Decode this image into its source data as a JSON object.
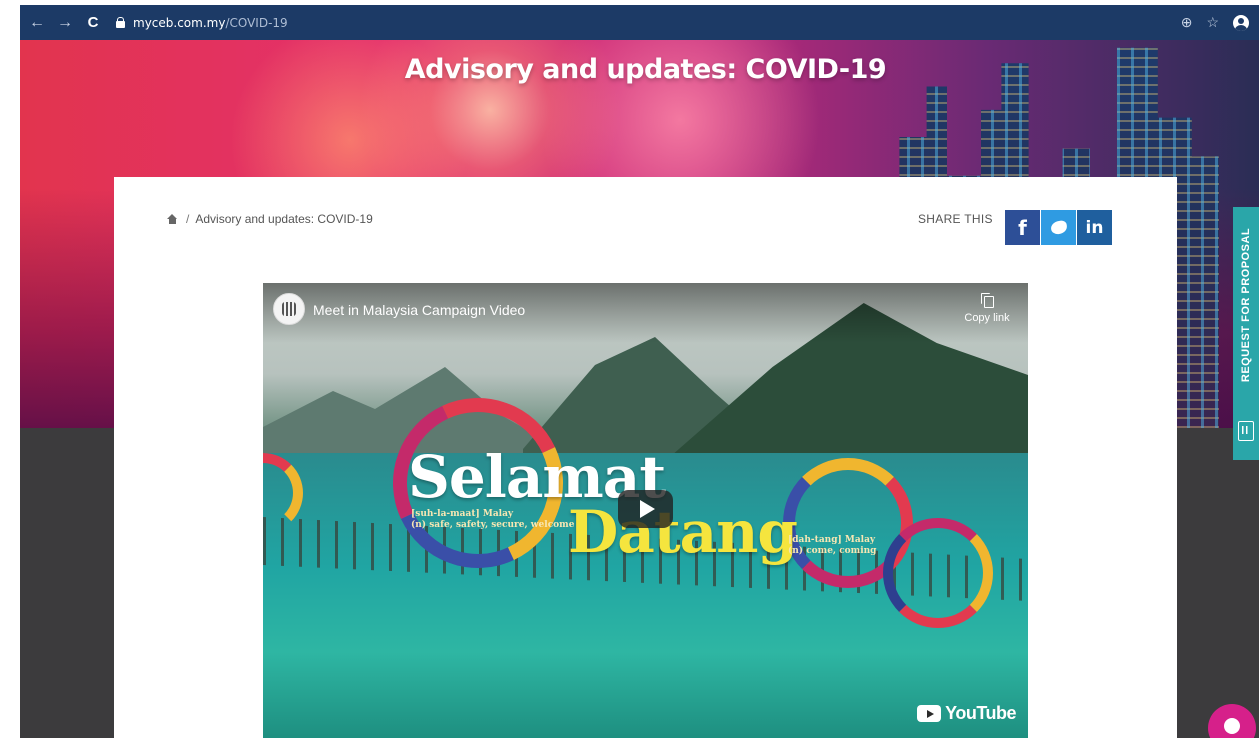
{
  "browser": {
    "url_host": "myceb.com.my",
    "url_path": "/COVID-19"
  },
  "hero": {
    "title": "Advisory and updates: COVID-19"
  },
  "breadcrumb": {
    "separator": "/",
    "current": "Advisory and updates: COVID-19"
  },
  "share": {
    "label": "SHARE THIS",
    "facebook": "f",
    "linkedin": "in"
  },
  "video": {
    "title": "Meet in Malaysia Campaign Video",
    "copy_link": "Copy link",
    "word_1": "Selamat",
    "word_1_gloss_1": "[suh-la-maat] Malay",
    "word_1_gloss_2": "(n) safe, safety, secure, welcome",
    "word_2": "Datang",
    "word_2_gloss_1": "[dah-tang] Malay",
    "word_2_gloss_2": "(n) come, coming",
    "brand": "YouTube"
  },
  "sidebar_tab": {
    "label": "REQUEST FOR PROPOSAL"
  },
  "colors": {
    "browser_bar": "#1c3a66",
    "facebook": "#2d4f97",
    "twitter": "#2f9be2",
    "linkedin": "#1f5f9e",
    "rfp_tab": "#2aa6a9",
    "chat": "#d6208a"
  },
  "icons": [
    "back-arrow-icon",
    "forward-arrow-icon",
    "reload-icon",
    "lock-icon",
    "zoom-icon",
    "star-icon",
    "profile-icon",
    "home-icon",
    "facebook-icon",
    "twitter-icon",
    "linkedin-icon",
    "copy-icon",
    "play-icon",
    "youtube-icon",
    "proposal-icon",
    "chat-icon"
  ]
}
